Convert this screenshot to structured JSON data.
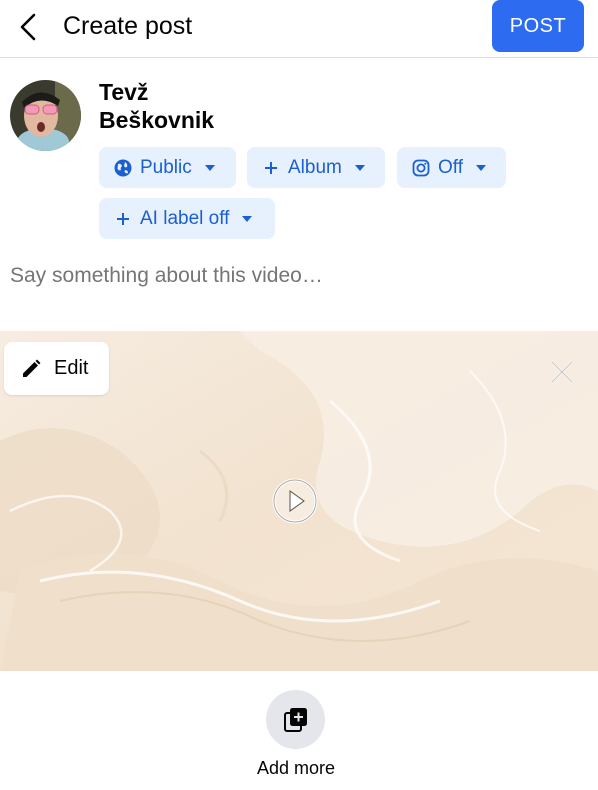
{
  "header": {
    "title": "Create post",
    "post_label": "POST"
  },
  "user": {
    "first_name": "Tevž",
    "last_name": "Beškovnik"
  },
  "audience_chips": [
    {
      "label": "Public",
      "icon": "globe-icon"
    },
    {
      "label": "Album",
      "icon": "plus-icon"
    },
    {
      "label": "Off",
      "icon": "instagram-icon"
    },
    {
      "label": "AI label off",
      "icon": "plus-icon"
    }
  ],
  "composer": {
    "placeholder": "Say something about this video…"
  },
  "media": {
    "edit_label": "Edit",
    "type": "video"
  },
  "footer": {
    "add_more_label": "Add more"
  },
  "colors": {
    "primary": "#2d6bf0",
    "chip_bg": "#e7f0fd",
    "chip_text": "#1b5fd1",
    "divider": "#dadde1"
  }
}
